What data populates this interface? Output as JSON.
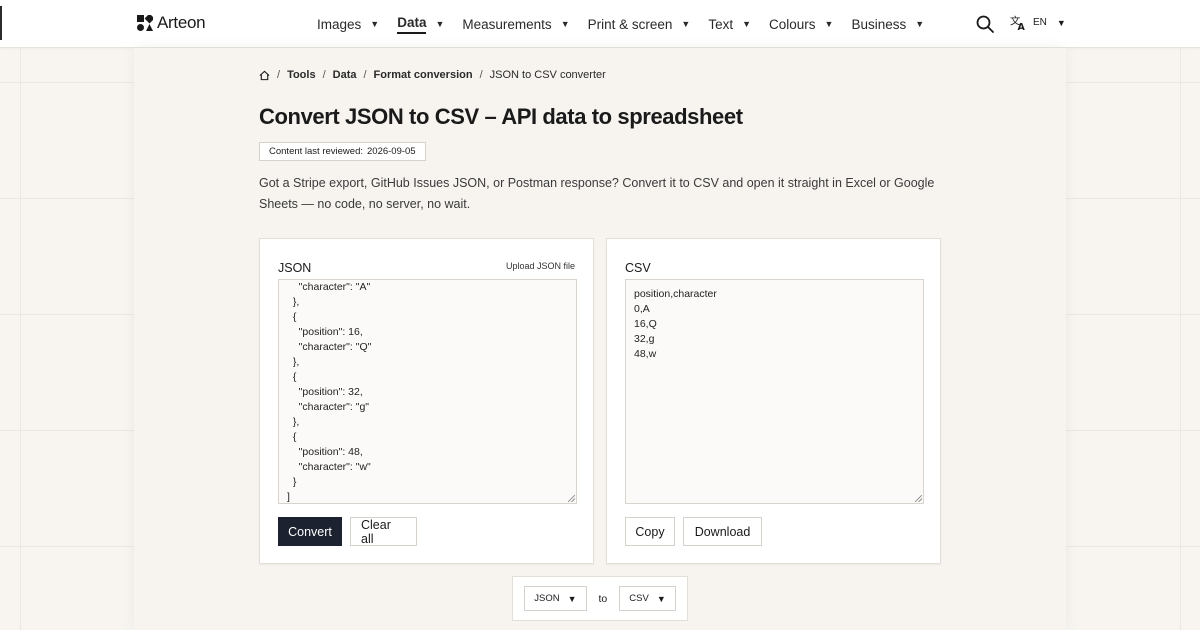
{
  "header": {
    "logo": "Arteon",
    "nav": [
      {
        "label": "Images",
        "active": false
      },
      {
        "label": "Data",
        "active": true
      },
      {
        "label": "Measurements",
        "active": false
      },
      {
        "label": "Print & screen",
        "active": false
      },
      {
        "label": "Text",
        "active": false
      },
      {
        "label": "Colours",
        "active": false
      },
      {
        "label": "Business",
        "active": false
      }
    ],
    "caret": "▼",
    "language": "EN",
    "icons": {
      "logo": "arteon-logo-icon",
      "search": "search-icon",
      "language": "translate-icon"
    }
  },
  "breadcrumb": {
    "home_icon": "home-icon",
    "separator": "/",
    "items": [
      "Tools",
      "Data",
      "Format conversion"
    ],
    "current": "JSON to CSV converter"
  },
  "page": {
    "title": "Convert JSON to CSV – API data to spreadsheet",
    "reviewed_label": "Content last reviewed:",
    "reviewed_date": "2026-09-05",
    "intro": "Got a Stripe export, GitHub Issues JSON, or Postman response? Convert it to CSV and open it straight in Excel or Google Sheets — no code, no server, no wait."
  },
  "json_panel": {
    "label": "JSON",
    "upload_link": "Upload JSON file",
    "content": "    \"character\": \"A\"\n  },\n  {\n    \"position\": 16,\n    \"character\": \"Q\"\n  },\n  {\n    \"position\": 32,\n    \"character\": \"g\"\n  },\n  {\n    \"position\": 48,\n    \"character\": \"w\"\n  }\n]",
    "convert_button": "Convert",
    "clear_button": "Clear all"
  },
  "csv_panel": {
    "label": "CSV",
    "content": "position,character\n0,A\n16,Q\n32,g\n48,w",
    "copy_button": "Copy",
    "download_button": "Download"
  },
  "format_switcher": {
    "from": "JSON",
    "to_word": "to",
    "to": "CSV"
  },
  "colors": {
    "primary_button": "#1c2230",
    "background": "#f8f5f1"
  }
}
